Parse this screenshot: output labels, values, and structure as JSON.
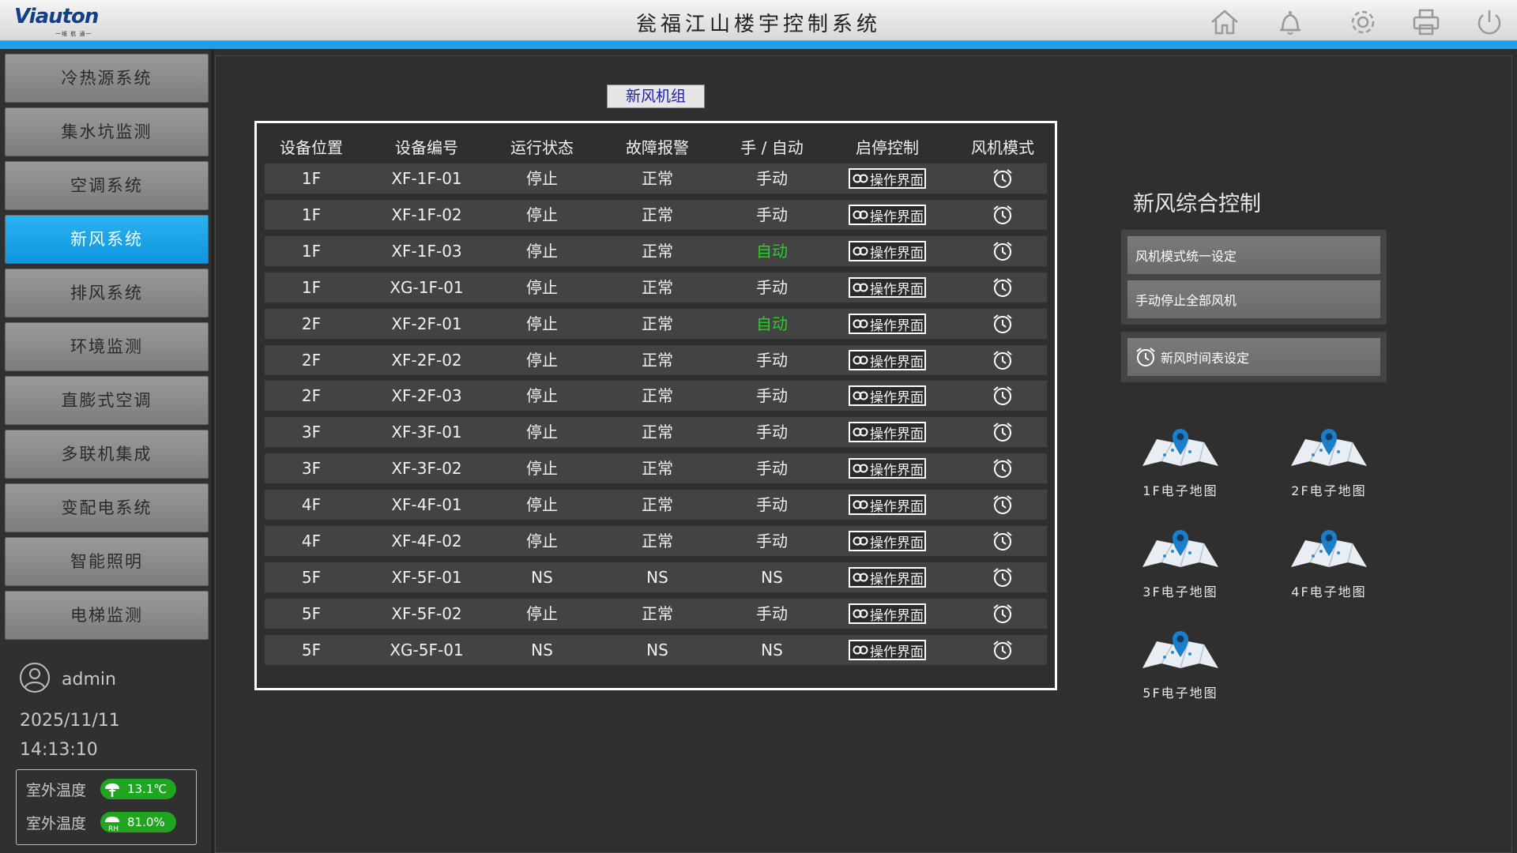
{
  "header": {
    "logo_text": "Viauton",
    "logo_sub": "一维 航 通一",
    "title": "瓮福江山楼宇控制系统",
    "icons": [
      "home-icon",
      "bell-icon",
      "gear-icon",
      "printer-icon",
      "power-icon"
    ]
  },
  "sidebar": {
    "items": [
      {
        "label": "冷热源系统"
      },
      {
        "label": "集水坑监测"
      },
      {
        "label": "空调系统"
      },
      {
        "label": "新风系统",
        "active": true
      },
      {
        "label": "排风系统"
      },
      {
        "label": "环境监测"
      },
      {
        "label": "直膨式空调"
      },
      {
        "label": "多联机集成"
      },
      {
        "label": "变配电系统"
      },
      {
        "label": "智能照明"
      },
      {
        "label": "电梯监测"
      }
    ],
    "user": "admin",
    "date": "2025/11/11",
    "time": "14:13:10",
    "env": {
      "temp_label": "室外温度",
      "temp_value": "13.1℃",
      "humidity_label": "室外温度",
      "humidity_value": "81.0%"
    }
  },
  "main": {
    "group_label": "新风机组",
    "columns": [
      "设备位置",
      "设备编号",
      "运行状态",
      "故障报警",
      "手 / 自动",
      "启停控制",
      "风机模式"
    ],
    "op_label": "操作界面",
    "rows": [
      {
        "loc": "1F",
        "id": "XF-1F-01",
        "run": "停止",
        "fault": "正常",
        "mode": "手动"
      },
      {
        "loc": "1F",
        "id": "XF-1F-02",
        "run": "停止",
        "fault": "正常",
        "mode": "手动"
      },
      {
        "loc": "1F",
        "id": "XF-1F-03",
        "run": "停止",
        "fault": "正常",
        "mode": "自动"
      },
      {
        "loc": "1F",
        "id": "XG-1F-01",
        "run": "停止",
        "fault": "正常",
        "mode": "手动"
      },
      {
        "loc": "2F",
        "id": "XF-2F-01",
        "run": "停止",
        "fault": "正常",
        "mode": "自动"
      },
      {
        "loc": "2F",
        "id": "XF-2F-02",
        "run": "停止",
        "fault": "正常",
        "mode": "手动"
      },
      {
        "loc": "2F",
        "id": "XF-2F-03",
        "run": "停止",
        "fault": "正常",
        "mode": "手动"
      },
      {
        "loc": "3F",
        "id": "XF-3F-01",
        "run": "停止",
        "fault": "正常",
        "mode": "手动"
      },
      {
        "loc": "3F",
        "id": "XF-3F-02",
        "run": "停止",
        "fault": "正常",
        "mode": "手动"
      },
      {
        "loc": "4F",
        "id": "XF-4F-01",
        "run": "停止",
        "fault": "正常",
        "mode": "手动"
      },
      {
        "loc": "4F",
        "id": "XF-4F-02",
        "run": "停止",
        "fault": "正常",
        "mode": "手动"
      },
      {
        "loc": "5F",
        "id": "XF-5F-01",
        "run": "NS",
        "fault": "NS",
        "mode": "NS"
      },
      {
        "loc": "5F",
        "id": "XF-5F-02",
        "run": "停止",
        "fault": "正常",
        "mode": "手动"
      },
      {
        "loc": "5F",
        "id": "XG-5F-01",
        "run": "NS",
        "fault": "NS",
        "mode": "NS"
      }
    ]
  },
  "control": {
    "title": "新风综合控制",
    "btn_mode": "风机模式统一设定",
    "btn_stop": "手动停止全部风机",
    "btn_schedule": "新风时间表设定"
  },
  "maps": [
    {
      "label": "1F电子地图"
    },
    {
      "label": "2F电子地图"
    },
    {
      "label": "3F电子地图"
    },
    {
      "label": "4F电子地图"
    },
    {
      "label": "5F电子地图"
    }
  ],
  "colors": {
    "accent_blue": "#1aa3ec",
    "auto_green": "#2ecc2e",
    "pill_green": "#20a520",
    "group_label_text": "#2020a8"
  }
}
